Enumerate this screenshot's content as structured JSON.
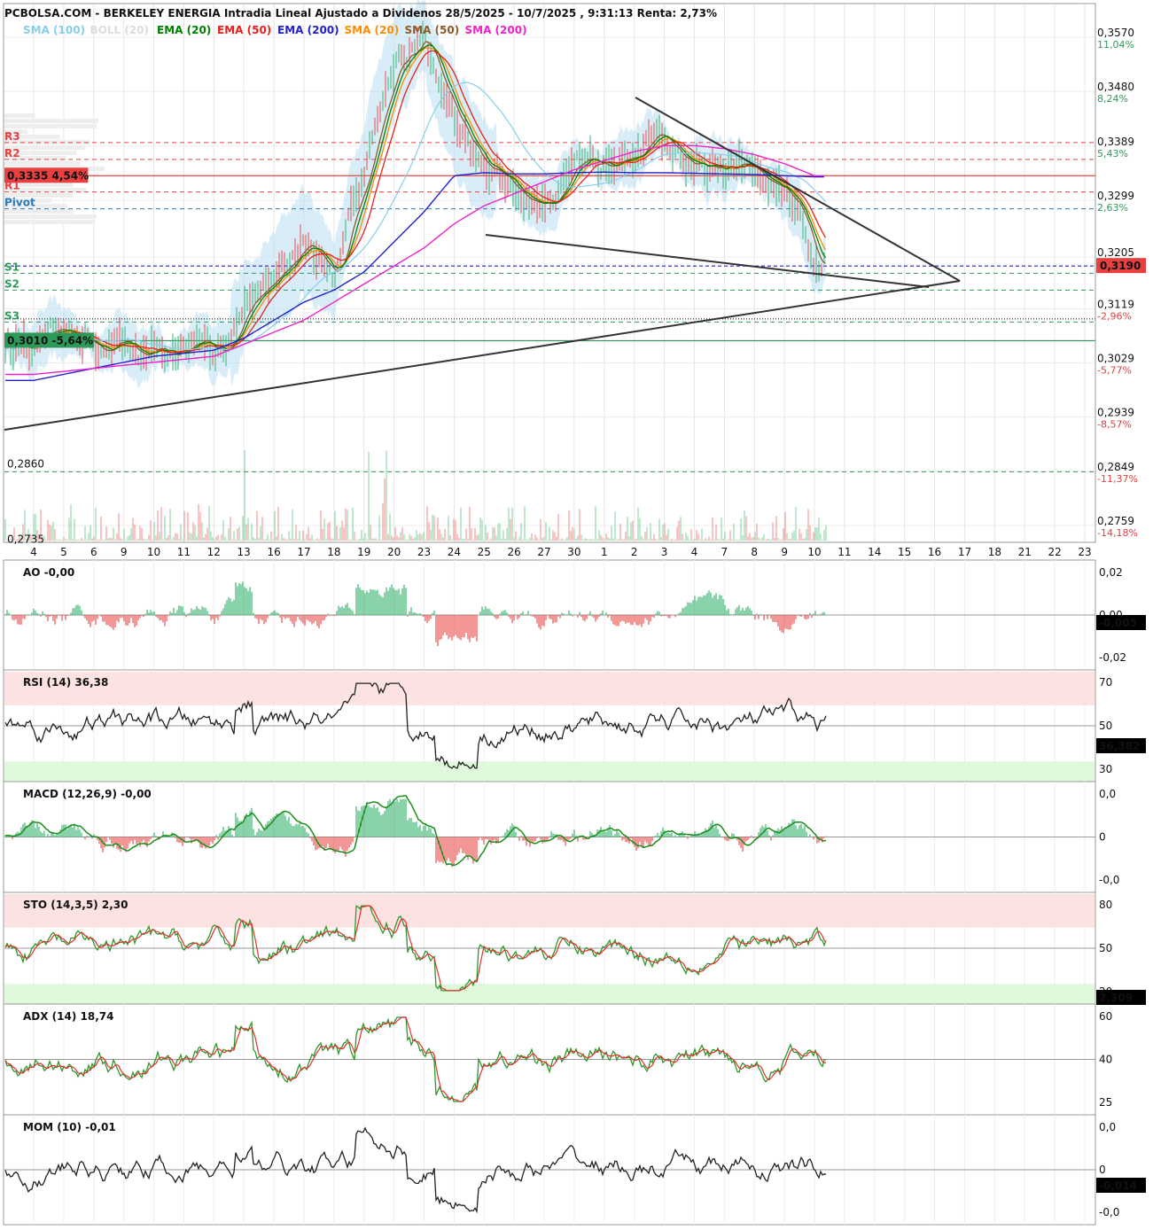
{
  "header": {
    "title": "PCBOLSA.COM - BERKELEY ENERGIA Intradia Lineal Ajustado a Dividenos 28/5/2025 - 10/7/2025 , 9:31:13 Renta: 2,73%"
  },
  "legend": [
    {
      "label": "SMA (100)",
      "color": "#87ceeb"
    },
    {
      "label": "BOLL (20)",
      "color": "#dddddd"
    },
    {
      "label": "EMA (20)",
      "color": "#008000"
    },
    {
      "label": "EMA (50)",
      "color": "#e8201c"
    },
    {
      "label": "EMA (200)",
      "color": "#2222cc"
    },
    {
      "label": "SMA (20)",
      "color": "#ff8c00"
    },
    {
      "label": "SMA (50)",
      "color": "#8b5a2b"
    },
    {
      "label": "SMA (200)",
      "color": "#ee22cc"
    }
  ],
  "price_axis": [
    {
      "price": "0,3570",
      "pct": "11,04%",
      "value": 0.357,
      "pct_color": "#2e9a5a"
    },
    {
      "price": "0,3480",
      "pct": "8,24%",
      "value": 0.348,
      "pct_color": "#2e9a5a"
    },
    {
      "price": "0,3389",
      "pct": "5,43%",
      "value": 0.3389,
      "pct_color": "#2e9a5a"
    },
    {
      "price": "0,3299",
      "pct": "2,63%",
      "value": 0.3299,
      "pct_color": "#2e9a5a"
    },
    {
      "price": "0,3205",
      "pct": "",
      "value": 0.3205,
      "pct_color": "#2e9a5a"
    },
    {
      "price": "0,3119",
      "pct": "-2,96%",
      "value": 0.3119,
      "pct_color": "#e04040"
    },
    {
      "price": "0,3029",
      "pct": "-5,77%",
      "value": 0.3029,
      "pct_color": "#e04040"
    },
    {
      "price": "0,2939",
      "pct": "-8,57%",
      "value": 0.2939,
      "pct_color": "#e04040"
    },
    {
      "price": "0,2849",
      "pct": "-11,37%",
      "value": 0.2849,
      "pct_color": "#e04040"
    },
    {
      "price": "0,2759",
      "pct": "-14,18%",
      "value": 0.2759,
      "pct_color": "#e04040"
    }
  ],
  "current_price": {
    "label": "0,3190",
    "value": 0.319,
    "color": "#e84040"
  },
  "levels": [
    {
      "name": "R3",
      "value": 0.3395,
      "color": "#e84040"
    },
    {
      "name": "R2",
      "value": 0.3367,
      "color": "#e84040"
    },
    {
      "name": "R1",
      "value": 0.3313,
      "color": "#e84040"
    },
    {
      "name": "Pivot",
      "value": 0.3285,
      "color": "#2a7ab8"
    },
    {
      "name": "S1",
      "value": 0.3178,
      "color": "#2e9a5a"
    },
    {
      "name": "S2",
      "value": 0.315,
      "color": "#2e9a5a"
    },
    {
      "name": "S3",
      "value": 0.3097,
      "color": "#2e9a5a"
    }
  ],
  "box_levels": [
    {
      "label": "0,3335  4,54%",
      "value": 0.334,
      "color": "#e84040"
    },
    {
      "label": "0,3010  -5,64%",
      "value": 0.3066,
      "color": "#2e9a5a"
    }
  ],
  "extra_levels": [
    {
      "label": "0,2860",
      "value": 0.286
    },
    {
      "label": "0,2735",
      "value": 0.2735
    }
  ],
  "x_ticks": [
    "4",
    "5",
    "6",
    "9",
    "10",
    "11",
    "12",
    "13",
    "16",
    "17",
    "18",
    "19",
    "20",
    "23",
    "24",
    "25",
    "26",
    "27",
    "30",
    "1",
    "2",
    "3",
    "4",
    "7",
    "8",
    "9",
    "10",
    "11",
    "14",
    "15",
    "16",
    "17",
    "18",
    "21",
    "22",
    "23"
  ],
  "panels": [
    {
      "id": "ao",
      "label": "AO",
      "value": "-0,00",
      "ticks": [
        {
          "t": "0,02",
          "c": "#111"
        },
        {
          "t": "0,00",
          "c": "#111"
        },
        {
          "t": "-0,02",
          "c": "#111"
        }
      ],
      "box": "-0,005"
    },
    {
      "id": "rsi",
      "label": "RSI (14)",
      "value": "36,38",
      "ticks": [
        {
          "t": "70",
          "c": "#e04040"
        },
        {
          "t": "50",
          "c": "#111"
        },
        {
          "t": "30",
          "c": "#2e9a5a"
        }
      ],
      "box": "36,382"
    },
    {
      "id": "macd",
      "label": "MACD (12,26,9)",
      "value": "-0,00",
      "ticks": [
        {
          "t": "0,0",
          "c": "#e04040"
        },
        {
          "t": "0",
          "c": "#111"
        },
        {
          "t": "-0,0",
          "c": "#2e9a5a"
        }
      ],
      "box": ""
    },
    {
      "id": "sto",
      "label": "STO (14,3,5)",
      "value": "2,30",
      "ticks": [
        {
          "t": "80",
          "c": "#e04040"
        },
        {
          "t": "50",
          "c": "#111"
        },
        {
          "t": "20",
          "c": "#2e9a5a"
        }
      ],
      "box": "2,309"
    },
    {
      "id": "adx",
      "label": "ADX (14)",
      "value": "18,74",
      "ticks": [
        {
          "t": "60",
          "c": "#e04040"
        },
        {
          "t": "40",
          "c": "#111"
        },
        {
          "t": "25",
          "c": "#2e9a5a"
        }
      ],
      "box": ""
    },
    {
      "id": "mom",
      "label": "MOM (10)",
      "value": "-0,01",
      "ticks": [
        {
          "t": "0,0",
          "c": "#e04040"
        },
        {
          "t": "0",
          "c": "#111"
        },
        {
          "t": "-0,0",
          "c": "#2e9a5a"
        }
      ],
      "box": "-0,014"
    }
  ],
  "chart_data": {
    "type": "line",
    "title": "PCBOLSA.COM - BERKELEY ENERGIA Intradia Lineal Ajustado a Dividenos 28/5/2025 - 10/7/2025 , 9:31:13 Renta: 2,73%",
    "ylim": [
      0.2735,
      0.359
    ],
    "x": [
      "4",
      "5",
      "6",
      "9",
      "10",
      "11",
      "12",
      "13",
      "16",
      "17",
      "18",
      "19",
      "20",
      "23",
      "24",
      "25",
      "26",
      "27",
      "30",
      "1",
      "2",
      "3",
      "4",
      "7",
      "8",
      "9",
      "10"
    ],
    "series": [
      {
        "name": "",
        "values": [
          0.306,
          0.3075,
          0.3072,
          0.3058,
          0.3052,
          0.305,
          0.3046,
          0.312,
          0.316,
          0.323,
          0.318,
          0.336,
          0.354,
          0.356,
          0.342,
          0.336,
          0.332,
          0.33,
          0.334,
          0.337,
          0.34,
          0.339,
          0.336,
          0.335,
          0.334,
          0.33,
          0.319
        ]
      },
      {
        "name": "EMA (200)",
        "values": [
          0.3,
          0.301,
          0.302,
          0.303,
          0.304,
          0.3045,
          0.305,
          0.307,
          0.31,
          0.313,
          0.315,
          0.318,
          0.323,
          0.328,
          0.334,
          0.3345,
          0.3343,
          0.3343,
          0.3345,
          0.3346,
          0.3345,
          0.3345,
          0.3344,
          0.3343,
          0.3342,
          0.334,
          0.3338
        ]
      },
      {
        "name": "SMA (200)",
        "values": [
          0.301,
          0.3015,
          0.302,
          0.3025,
          0.303,
          0.3035,
          0.304,
          0.306,
          0.308,
          0.31,
          0.313,
          0.316,
          0.319,
          0.322,
          0.326,
          0.329,
          0.331,
          0.333,
          0.335,
          0.3365,
          0.338,
          0.339,
          0.339,
          0.3385,
          0.3375,
          0.336,
          0.334
        ]
      }
    ]
  }
}
